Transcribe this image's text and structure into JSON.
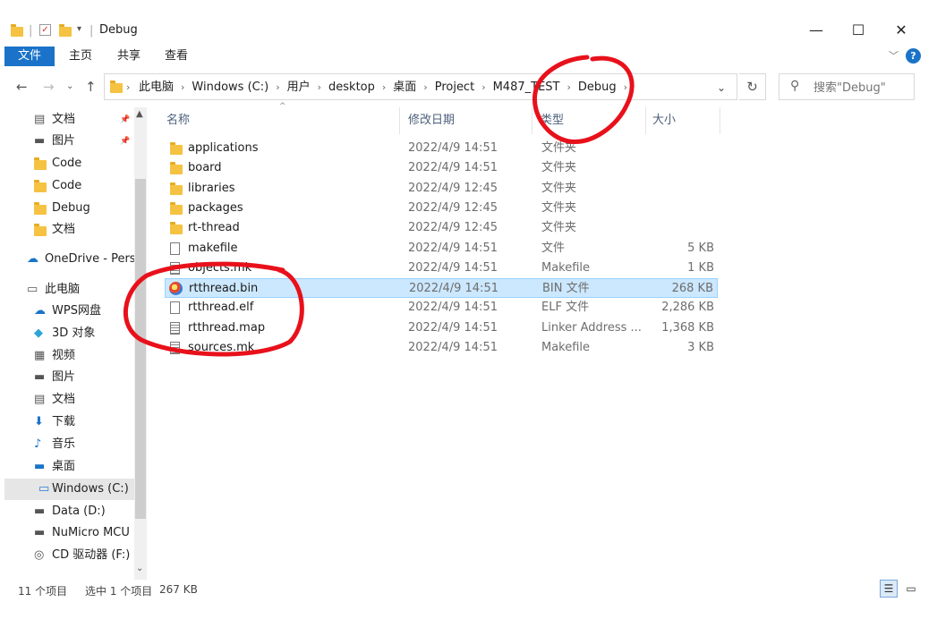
{
  "window": {
    "title": "Debug"
  },
  "window_controls": {
    "minimize": "—",
    "maximize": "☐",
    "close": "✕"
  },
  "ribbon": {
    "tabs": [
      "文件",
      "主页",
      "共享",
      "查看"
    ]
  },
  "address": {
    "crumbs": [
      "此电脑",
      "Windows (C:)",
      "用户",
      "desktop",
      "桌面",
      "Project",
      "M487_TEST",
      "Debug"
    ]
  },
  "search": {
    "placeholder": "搜索\"Debug\""
  },
  "sidebar": {
    "items": [
      {
        "label": "文档",
        "icon": "document-icon",
        "pinned": true
      },
      {
        "label": "图片",
        "icon": "pictures-icon",
        "pinned": true
      },
      {
        "label": "Code",
        "icon": "folder-icon"
      },
      {
        "label": "Code",
        "icon": "folder-icon"
      },
      {
        "label": "Debug",
        "icon": "folder-icon"
      },
      {
        "label": "文档",
        "icon": "folder-icon"
      },
      {
        "label": "OneDrive - Perso",
        "icon": "onedrive-icon"
      },
      {
        "label": "此电脑",
        "icon": "this-pc-icon"
      },
      {
        "label": "WPS网盘",
        "icon": "wps-cloud-icon"
      },
      {
        "label": "3D 对象",
        "icon": "3d-objects-icon"
      },
      {
        "label": "视频",
        "icon": "video-icon"
      },
      {
        "label": "图片",
        "icon": "pictures-icon"
      },
      {
        "label": "文档",
        "icon": "document-icon"
      },
      {
        "label": "下载",
        "icon": "download-icon"
      },
      {
        "label": "音乐",
        "icon": "music-icon"
      },
      {
        "label": "桌面",
        "icon": "desktop-icon"
      },
      {
        "label": "Windows (C:)",
        "icon": "drive-c-icon",
        "selected": true
      },
      {
        "label": "Data (D:)",
        "icon": "drive-icon"
      },
      {
        "label": "NuMicro MCU",
        "icon": "drive-icon"
      },
      {
        "label": "CD 驱动器 (F:)",
        "icon": "cd-drive-icon"
      }
    ]
  },
  "columns": {
    "name": "名称",
    "modified": "修改日期",
    "type": "类型",
    "size": "大小"
  },
  "files": [
    {
      "name": "applications",
      "modified": "2022/4/9 14:51",
      "type": "文件夹",
      "size": "",
      "icon": "folder-icon"
    },
    {
      "name": "board",
      "modified": "2022/4/9 14:51",
      "type": "文件夹",
      "size": "",
      "icon": "folder-icon"
    },
    {
      "name": "libraries",
      "modified": "2022/4/9 12:45",
      "type": "文件夹",
      "size": "",
      "icon": "folder-icon"
    },
    {
      "name": "packages",
      "modified": "2022/4/9 12:45",
      "type": "文件夹",
      "size": "",
      "icon": "folder-icon"
    },
    {
      "name": "rt-thread",
      "modified": "2022/4/9 12:45",
      "type": "文件夹",
      "size": "",
      "icon": "folder-icon"
    },
    {
      "name": "makefile",
      "modified": "2022/4/9 14:51",
      "type": "文件",
      "size": "5 KB",
      "icon": "file-icon"
    },
    {
      "name": "objects.mk",
      "modified": "2022/4/9 14:51",
      "type": "Makefile",
      "size": "1 KB",
      "icon": "makefile-icon"
    },
    {
      "name": "rtthread.bin",
      "modified": "2022/4/9 14:51",
      "type": "BIN 文件",
      "size": "268 KB",
      "icon": "bin-file-icon",
      "selected": true
    },
    {
      "name": "rtthread.elf",
      "modified": "2022/4/9 14:51",
      "type": "ELF 文件",
      "size": "2,286 KB",
      "icon": "file-icon"
    },
    {
      "name": "rtthread.map",
      "modified": "2022/4/9 14:51",
      "type": "Linker Address ...",
      "size": "1,368 KB",
      "icon": "text-file-icon"
    },
    {
      "name": "sources.mk",
      "modified": "2022/4/9 14:51",
      "type": "Makefile",
      "size": "3 KB",
      "icon": "makefile-icon"
    }
  ],
  "status": {
    "item_count": "11 个项目",
    "selection": "选中 1 个项目",
    "selection_size": "267 KB"
  },
  "colors": {
    "accent": "#1a73c8",
    "selection": "#cce8ff",
    "annotation_red": "#e8111b"
  }
}
